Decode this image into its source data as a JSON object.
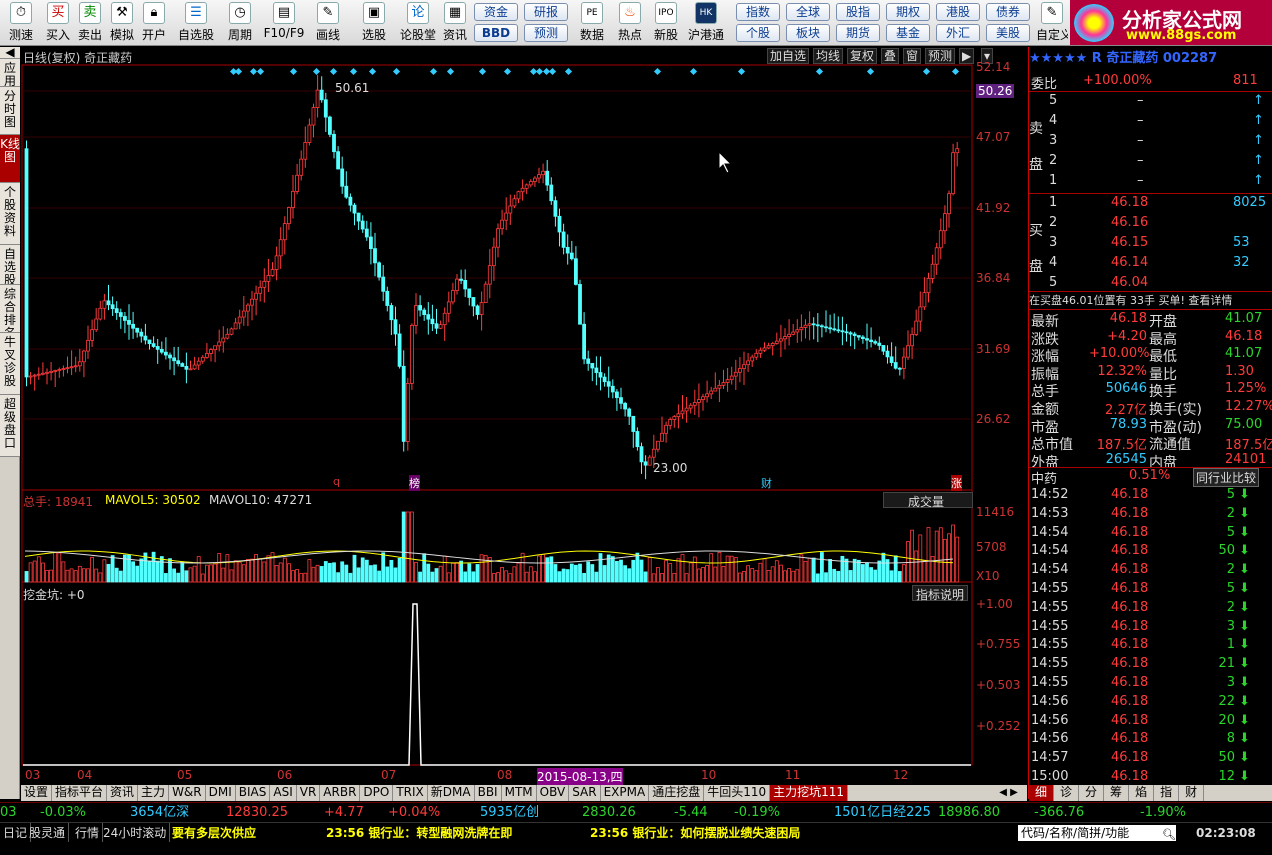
{
  "toolbar": {
    "buttons": [
      {
        "label": "测速",
        "icon": "clock-icon"
      },
      {
        "label": "买入",
        "icon": "buy-icon"
      },
      {
        "label": "卖出",
        "icon": "sell-icon"
      },
      {
        "label": "模拟",
        "icon": "hammer-icon"
      },
      {
        "label": "开户",
        "icon": "lock-icon"
      },
      {
        "label": "自选股",
        "icon": "star-list-icon"
      },
      {
        "label": "周期",
        "icon": "cycle-icon"
      },
      {
        "label": "F10/F9",
        "icon": "f10-icon"
      },
      {
        "label": "画线",
        "icon": "pencil-icon"
      },
      {
        "label": "选股",
        "icon": "screen-icon"
      },
      {
        "label": "论股堂",
        "icon": "forum-icon"
      },
      {
        "label": "资讯",
        "icon": "news-icon"
      },
      {
        "label": "数据",
        "icon": "pe-icon"
      },
      {
        "label": "热点",
        "icon": "hot-icon"
      },
      {
        "label": "新股",
        "icon": "ipo-icon"
      },
      {
        "label": "沪港通",
        "icon": "hk-icon"
      },
      {
        "label": "自定义",
        "icon": "custom-icon"
      }
    ],
    "buy_glyph": "买",
    "sell_glyph": "卖",
    "forum_glyph": "论",
    "pills": [
      "资金",
      "研报",
      "BBD",
      "预测",
      "指数",
      "全球",
      "股指",
      "期权",
      "港股",
      "债券",
      "个股",
      "板块",
      "期货",
      "基金",
      "外汇",
      "美股"
    ]
  },
  "logo": {
    "title": "分析家公式网",
    "url": "www.88gs.com"
  },
  "left_tabs": [
    "应用",
    "分时图",
    "K线图",
    "个股资料",
    "自选股",
    "综合排名",
    "牛叉诊股",
    "超级盘口"
  ],
  "left_top_glyph": "◀",
  "chart": {
    "header": "日线(复权) 奇正藏药",
    "header_buttons": [
      "加自选",
      "均线",
      "复权",
      "叠",
      "窗",
      "预测",
      "▶",
      "▾"
    ],
    "price_axis": [
      "52.14",
      "50.26",
      "47.07",
      "41.92",
      "36.84",
      "31.69",
      "26.62"
    ],
    "high_label": "50.61",
    "low_label": "23.00",
    "markers": [
      "q",
      "榜",
      "财",
      "涨"
    ],
    "volume_header": {
      "total": "总手: 18941",
      "ma5": "MAVOL5: 30502",
      "ma10": "MAVOL10: 47271"
    },
    "volume_button": "成交量",
    "volume_axis": [
      "11416",
      "5708",
      "X10"
    ],
    "indicator_header": "挖金坑: +0",
    "indicator_button": "指标说明",
    "indicator_axis": [
      "+1.00",
      "+0.755",
      "+0.503",
      "+0.252"
    ],
    "date_axis": [
      "03",
      "04",
      "05",
      "06",
      "07",
      "08",
      "2015-08-13,四",
      "10",
      "11",
      "12"
    ]
  },
  "bottom_tabs": [
    "设置",
    "指标平台",
    "资讯",
    "主力",
    "W&R",
    "DMI",
    "BIAS",
    "ASI",
    "VR",
    "ARBR",
    "DPO",
    "TRIX",
    "新DMA",
    "BBI",
    "MTM",
    "OBV",
    "SAR",
    "EXPMA",
    "通庄挖盘",
    "牛回头110",
    "主力挖坑111"
  ],
  "right": {
    "title": "★★★★★ R 奇正藏药 002287",
    "weibi": {
      "label": "委比",
      "value": "+100.00%",
      "diff": "811"
    },
    "sell": [
      {
        "n": "5",
        "p": "–",
        "v": ""
      },
      {
        "n": "4",
        "p": "–",
        "v": ""
      },
      {
        "n": "3",
        "p": "–",
        "v": ""
      },
      {
        "n": "2",
        "p": "–",
        "v": ""
      },
      {
        "n": "1",
        "p": "–",
        "v": ""
      }
    ],
    "buy": [
      {
        "n": "1",
        "p": "46.18",
        "v": "8025"
      },
      {
        "n": "2",
        "p": "46.16",
        "v": ""
      },
      {
        "n": "3",
        "p": "46.15",
        "v": "53"
      },
      {
        "n": "4",
        "p": "46.14",
        "v": "32"
      },
      {
        "n": "5",
        "p": "46.04",
        "v": ""
      }
    ],
    "sell_label": "卖盘",
    "buy_label": "买盘",
    "notice": "在买盘46.01位置有 33手 买单! 查看详情",
    "stats": [
      [
        "最新",
        "46.18",
        "开盘",
        "41.07"
      ],
      [
        "涨跌",
        "+4.20",
        "最高",
        "46.18"
      ],
      [
        "涨幅",
        "+10.00%",
        "最低",
        "41.07"
      ],
      [
        "振幅",
        "12.32%",
        "量比",
        "1.30"
      ],
      [
        "总手",
        "50646",
        "换手",
        "1.25%"
      ],
      [
        "金额",
        "2.27亿",
        "换手(实)",
        "12.27%"
      ],
      [
        "市盈",
        "78.93",
        "市盈(动)",
        "75.00"
      ],
      [
        "总市值",
        "187.5亿",
        "流通值",
        "187.5亿"
      ],
      [
        "外盘",
        "26545",
        "内盘",
        "24101"
      ]
    ],
    "industry": {
      "name": "中药",
      "pct": "0.51%",
      "btn": "同行业比较"
    },
    "ticks": [
      [
        "14:52",
        "46.18",
        "5"
      ],
      [
        "14:53",
        "46.18",
        "2"
      ],
      [
        "14:54",
        "46.18",
        "5"
      ],
      [
        "14:54",
        "46.18",
        "50"
      ],
      [
        "14:54",
        "46.18",
        "2"
      ],
      [
        "14:55",
        "46.18",
        "5"
      ],
      [
        "14:55",
        "46.18",
        "2"
      ],
      [
        "14:55",
        "46.18",
        "3"
      ],
      [
        "14:55",
        "46.18",
        "1"
      ],
      [
        "14:55",
        "46.18",
        "21"
      ],
      [
        "14:55",
        "46.18",
        "3"
      ],
      [
        "14:56",
        "46.18",
        "22"
      ],
      [
        "14:56",
        "46.18",
        "20"
      ],
      [
        "14:56",
        "46.18",
        "8"
      ],
      [
        "14:57",
        "46.18",
        "50"
      ],
      [
        "15:00",
        "46.18",
        "12"
      ]
    ],
    "tabs": [
      "细",
      "诊",
      "分",
      "筹",
      "焰",
      "指",
      "财"
    ]
  },
  "status": [
    "03",
    "-0.03%",
    "3654亿深",
    "12830.25",
    "+4.77",
    "+0.04%",
    "5935亿创",
    "2830.26",
    "-5.44",
    "-0.19%",
    "1501亿日经225",
    "18986.80",
    "-366.76",
    "-1.90%"
  ],
  "news": {
    "left": [
      "日记",
      "股灵通",
      "行情",
      "24小时滚动"
    ],
    "items": [
      "要有多层次供应",
      "23:56 银行业：转型融网洗牌在即",
      "23:56 银行业：如何摆脱业绩失速困局"
    ],
    "search": "代码/名称/简拼/功能",
    "time": "02:23:08"
  }
}
